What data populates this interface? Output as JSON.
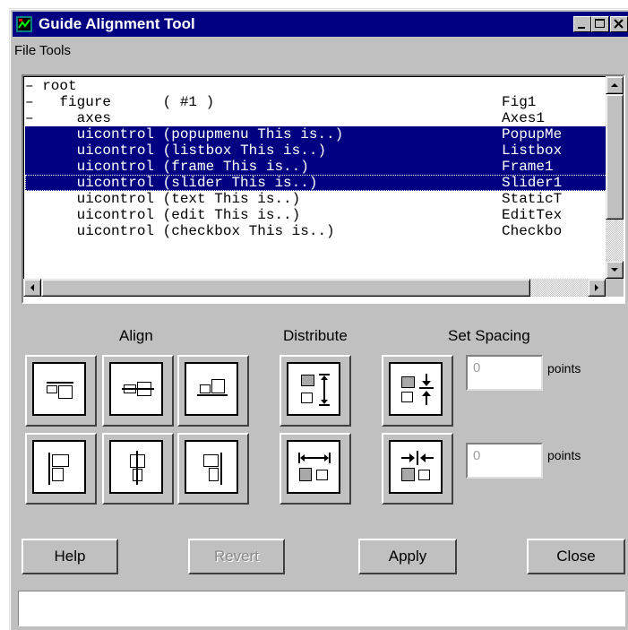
{
  "window": {
    "title": "Guide Alignment Tool"
  },
  "menubar": {
    "items": [
      "File",
      "Tools"
    ]
  },
  "tree": {
    "rows": [
      {
        "name": "– root",
        "tag": "",
        "selected": false
      },
      {
        "name": "–   figure      ( #1 )",
        "tag": "Fig1",
        "selected": false
      },
      {
        "name": "–     axes",
        "tag": "Axes1",
        "selected": false
      },
      {
        "name": "      uicontrol (popupmenu This is..)",
        "tag": "PopupMe",
        "selected": true
      },
      {
        "name": "      uicontrol (listbox This is..)",
        "tag": "Listbox",
        "selected": true
      },
      {
        "name": "      uicontrol (frame This is..)",
        "tag": "Frame1",
        "selected": true
      },
      {
        "name": "      uicontrol (slider This is..)",
        "tag": "Slider1",
        "selected": true,
        "focused": true
      },
      {
        "name": "      uicontrol (text This is..)",
        "tag": "StaticT",
        "selected": false
      },
      {
        "name": "      uicontrol (edit This is..)",
        "tag": "EditTex",
        "selected": false
      },
      {
        "name": "      uicontrol (checkbox This is..)",
        "tag": "Checkbo",
        "selected": false
      }
    ]
  },
  "sections": {
    "align": "Align",
    "distribute": "Distribute",
    "spacing": "Set Spacing"
  },
  "spacing": {
    "vertical_value": "0",
    "horizontal_value": "0",
    "unit_label": "points"
  },
  "buttons": {
    "help": "Help",
    "revert": "Revert",
    "apply": "Apply",
    "close": "Close"
  },
  "status": {
    "text": ""
  },
  "colors": {
    "selection": "#000080",
    "face": "#c0c0c0",
    "titlebar": "#000080"
  }
}
